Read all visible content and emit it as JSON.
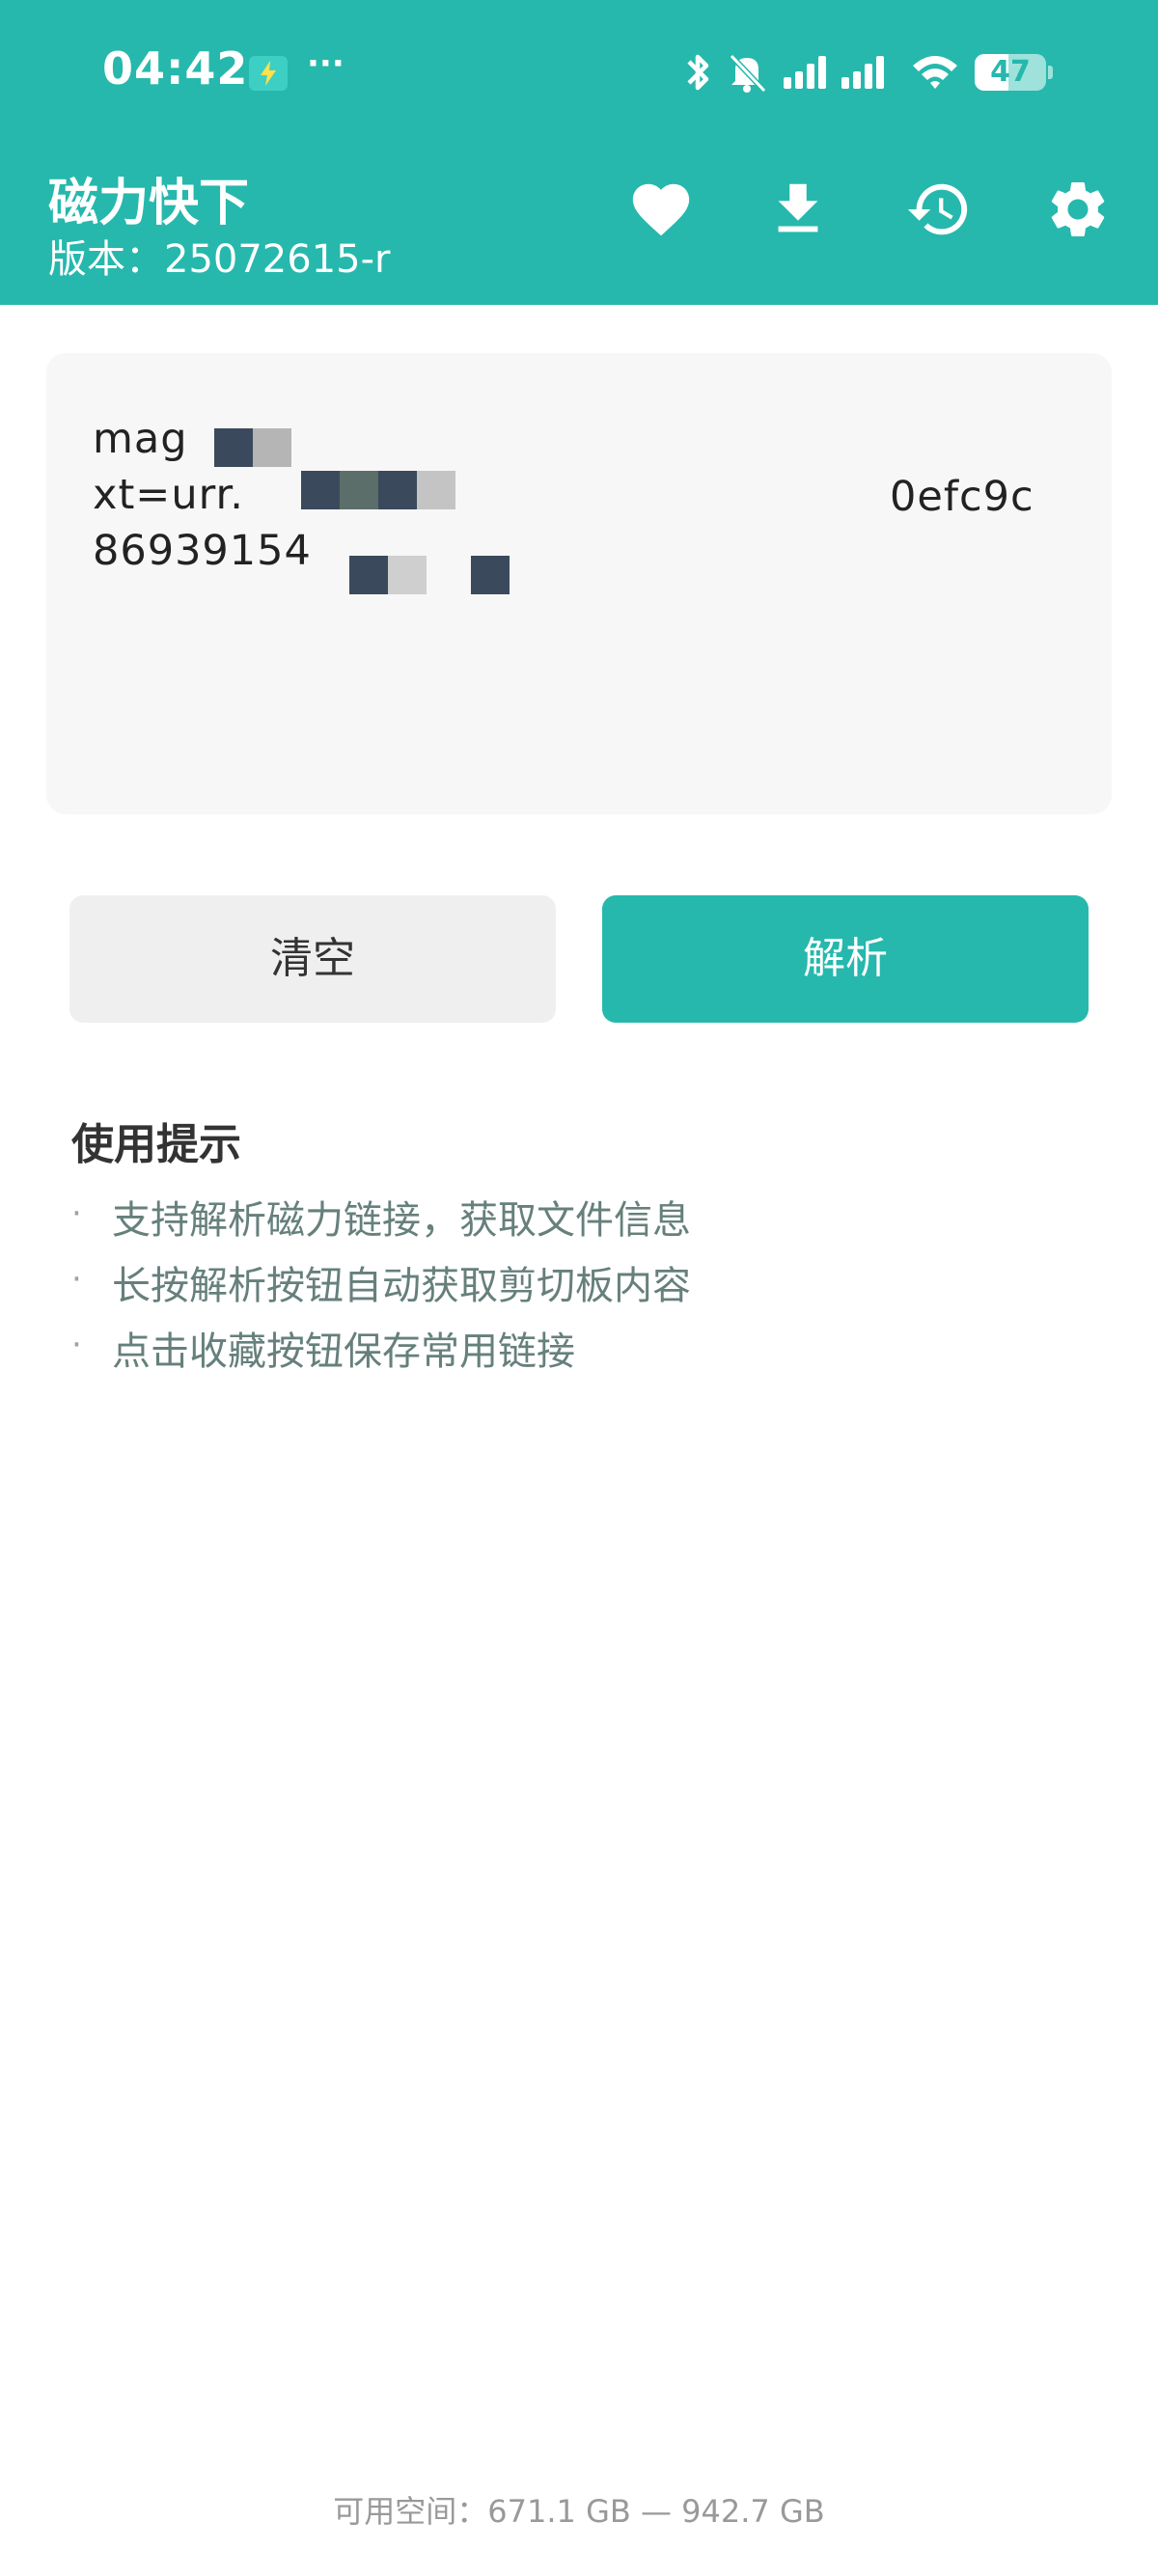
{
  "status_bar": {
    "time": "04:42",
    "more": "···",
    "battery": "47",
    "battery_level_percent": 47,
    "icons": [
      "charging-icon",
      "bluetooth-icon",
      "mute-icon",
      "signal-icon",
      "wifi-icon",
      "battery-icon"
    ]
  },
  "app_bar": {
    "title": "磁力快下",
    "version": "版本：25072615-r",
    "actions": [
      "heart-icon",
      "download-icon",
      "history-icon",
      "settings-icon"
    ]
  },
  "input": {
    "line1": "mag",
    "line2": "xt=urr.",
    "line2_tail": "0efc9c",
    "line3": "86939154"
  },
  "buttons": {
    "clear": "清空",
    "parse": "解析"
  },
  "tips": {
    "title": "使用提示",
    "bullet": "·",
    "items": [
      "支持解析磁力链接，获取文件信息",
      "长按解析按钮自动获取剪切板内容",
      "点击收藏按钮保存常用链接"
    ]
  },
  "footer": {
    "storage": "可用空间：671.1 GB — 942.7 GB"
  },
  "colors": {
    "primary": "#26b8ad",
    "clear_button_bg": "#efefef",
    "tip_text": "#66807c"
  }
}
